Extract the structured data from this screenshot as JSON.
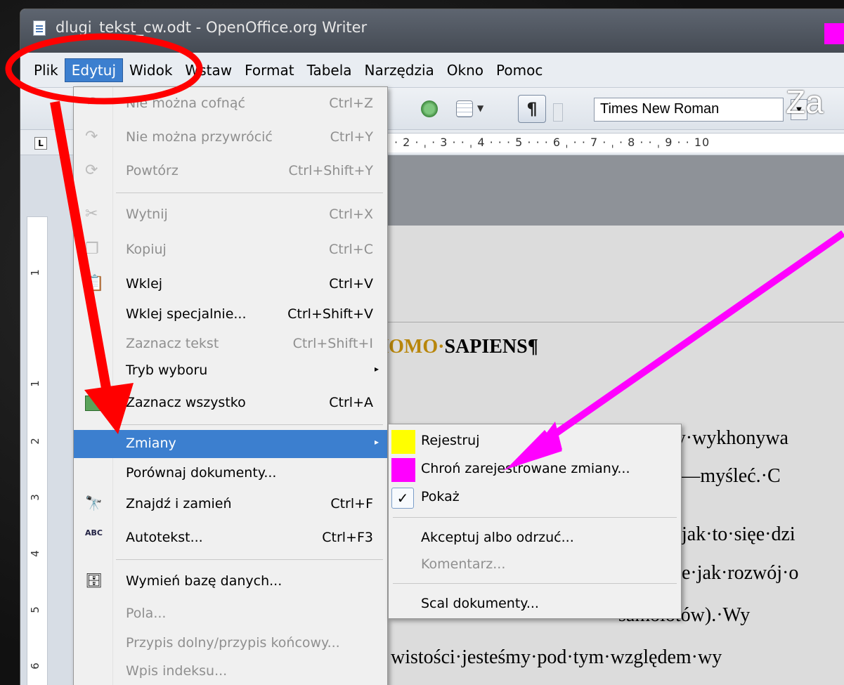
{
  "window": {
    "title": "dlugi_tekst_cw.odt - OpenOffice.org Writer",
    "swatch_color": "#ff00ff"
  },
  "menubar": {
    "items": [
      {
        "label": "Plik"
      },
      {
        "label": "Edytuj"
      },
      {
        "label": "Widok"
      },
      {
        "label": "Wstaw"
      },
      {
        "label": "Format"
      },
      {
        "label": "Tabela"
      },
      {
        "label": "Narzędzia"
      },
      {
        "label": "Okno"
      },
      {
        "label": "Pomoc"
      }
    ],
    "active": "Edytuj"
  },
  "toolbar": {
    "font_name": "Times New Roman",
    "overlay_text": "Za"
  },
  "ruler": {
    "marks": "· 2 · ˌ · 3 · · ˌ 4 · · · 5 · · · 6 ˌ · · 7 · ˌ · 8 · · ˌ 9 · · 10"
  },
  "vruler": {
    "numbers": [
      "1",
      "1",
      "2",
      "3",
      "4",
      "5",
      "6"
    ]
  },
  "document": {
    "heading_gold": "·HOMO·",
    "heading_bold": "SAPIENS¶",
    "lines": [
      "łby·wykhonywa",
      "o·—myśleć.·C",
      "jak·to·sięe·dzi",
      "e·jak·rozwój·o",
      "samolotów).·Wy",
      "wistości·jesteśmy·pod·tym·względem·wy"
    ]
  },
  "edit_menu": {
    "items": [
      {
        "label": "Nie można cofnąć",
        "shortcut": "Ctrl+Z",
        "disabled": true
      },
      {
        "label": "Nie można przywrócić",
        "shortcut": "Ctrl+Y",
        "disabled": true
      },
      {
        "label": "Powtórz",
        "shortcut": "Ctrl+Shift+Y",
        "disabled": true
      },
      {
        "label": "Wytnij",
        "shortcut": "Ctrl+X",
        "disabled": true
      },
      {
        "label": "Kopiuj",
        "shortcut": "Ctrl+C",
        "disabled": true
      },
      {
        "label": "Wklej",
        "shortcut": "Ctrl+V",
        "disabled": false
      },
      {
        "label": "Wklej specjalnie...",
        "shortcut": "Ctrl+Shift+V",
        "disabled": false
      },
      {
        "label": "Zaznacz tekst",
        "shortcut": "Ctrl+Shift+I",
        "disabled": true
      },
      {
        "label": "Tryb wyboru",
        "shortcut": "",
        "disabled": false
      },
      {
        "label": "Zaznacz wszystko",
        "shortcut": "Ctrl+A",
        "disabled": false
      },
      {
        "label": "Zmiany",
        "shortcut": "",
        "disabled": false
      },
      {
        "label": "Porównaj dokumenty...",
        "shortcut": "",
        "disabled": false
      },
      {
        "label": "Znajdź i zamień",
        "shortcut": "Ctrl+F",
        "disabled": false
      },
      {
        "label": "Autotekst...",
        "shortcut": "Ctrl+F3",
        "disabled": false
      },
      {
        "label": "Wymień bazę danych...",
        "shortcut": "",
        "disabled": false
      },
      {
        "label": "Pola...",
        "shortcut": "",
        "disabled": true
      },
      {
        "label": "Przypis dolny/przypis końcowy...",
        "shortcut": "",
        "disabled": true
      },
      {
        "label": "Wpis indeksu...",
        "shortcut": "",
        "disabled": true
      }
    ]
  },
  "changes_submenu": {
    "items": [
      {
        "label": "Rejestruj",
        "swatch": "#ffff00"
      },
      {
        "label": "Chroń zarejestrowane zmiany...",
        "swatch": "#ff00ff"
      },
      {
        "label": "Pokaż",
        "checked": true
      },
      {
        "label": "Akceptuj albo odrzuć..."
      },
      {
        "label": "Komentarz...",
        "disabled": true
      },
      {
        "label": "Scal dokumenty..."
      }
    ]
  },
  "annotations": {
    "circle_color": "#ff0000",
    "arrow_red": "#ff0000",
    "arrow_magenta": "#ff00ff"
  }
}
